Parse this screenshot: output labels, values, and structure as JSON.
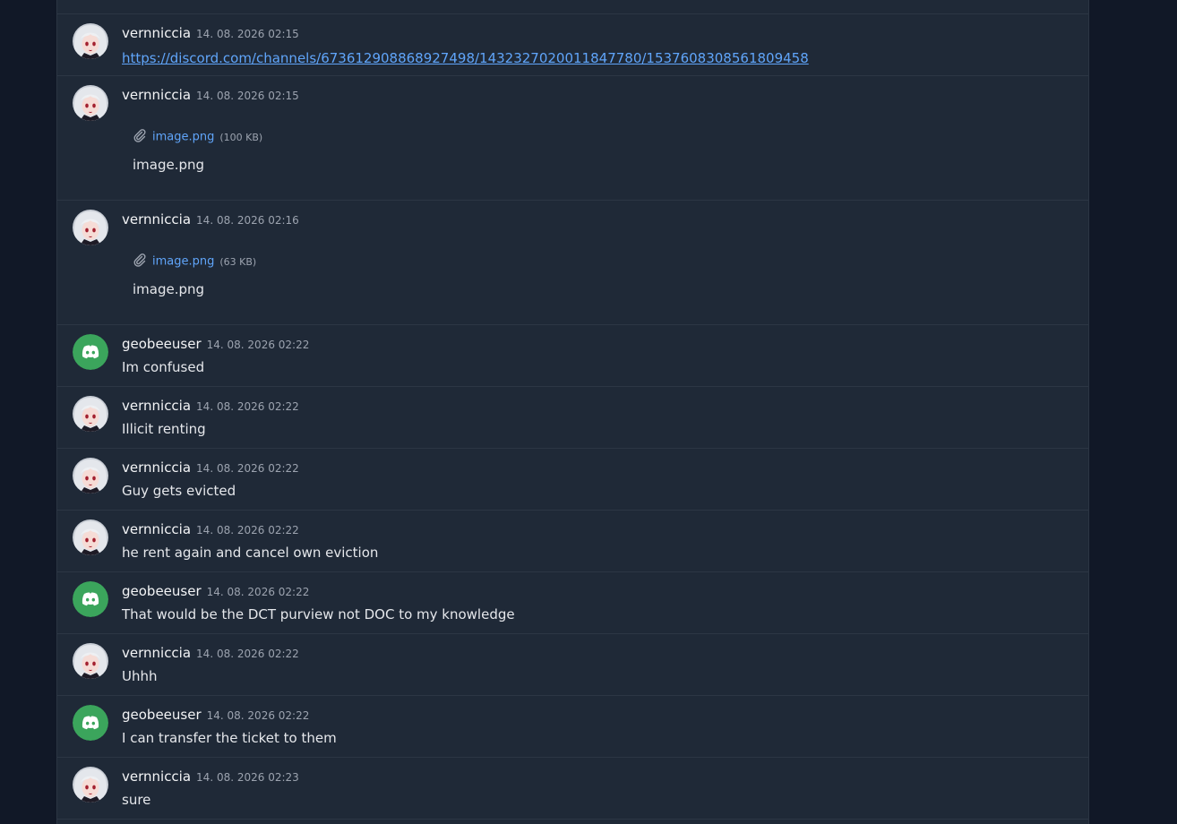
{
  "messages": [
    {
      "id": "m1",
      "author": "vernniccia",
      "timestamp": "14. 08. 2026 02:15",
      "avatar": "anime-avatar-icon",
      "link": "https://discord.com/channels/673612908868927498/1432327020011847780/1537608308561809458"
    },
    {
      "id": "m2",
      "author": "vernniccia",
      "timestamp": "14. 08. 2026 02:15",
      "avatar": "anime-avatar-icon",
      "attachment": {
        "name": "image.png",
        "size": "(100 KB)",
        "caption": "image.png"
      }
    },
    {
      "id": "m3",
      "author": "vernniccia",
      "timestamp": "14. 08. 2026 02:16",
      "avatar": "anime-avatar-icon",
      "attachment": {
        "name": "image.png",
        "size": "(63 KB)",
        "caption": "image.png"
      }
    },
    {
      "id": "m4",
      "author": "geobeeuser",
      "timestamp": "14. 08. 2026 02:22",
      "avatar": "discord-logo-icon",
      "text": "Im confused"
    },
    {
      "id": "m5",
      "author": "vernniccia",
      "timestamp": "14. 08. 2026 02:22",
      "avatar": "anime-avatar-icon",
      "text": "Illicit renting"
    },
    {
      "id": "m6",
      "author": "vernniccia",
      "timestamp": "14. 08. 2026 02:22",
      "avatar": "anime-avatar-icon",
      "text": "Guy gets evicted"
    },
    {
      "id": "m7",
      "author": "vernniccia",
      "timestamp": "14. 08. 2026 02:22",
      "avatar": "anime-avatar-icon",
      "text": "he rent again and cancel own eviction"
    },
    {
      "id": "m8",
      "author": "geobeeuser",
      "timestamp": "14. 08. 2026 02:22",
      "avatar": "discord-logo-icon",
      "text": "That would be the DCT purview not DOC to my knowledge"
    },
    {
      "id": "m9",
      "author": "vernniccia",
      "timestamp": "14. 08. 2026 02:22",
      "avatar": "anime-avatar-icon",
      "text": "Uhhh"
    },
    {
      "id": "m10",
      "author": "geobeeuser",
      "timestamp": "14. 08. 2026 02:22",
      "avatar": "discord-logo-icon",
      "text": "I can transfer the ticket to them"
    },
    {
      "id": "m11",
      "author": "vernniccia",
      "timestamp": "14. 08. 2026 02:23",
      "avatar": "anime-avatar-icon",
      "text": "sure"
    }
  ],
  "colors": {
    "background": "#111827",
    "panel": "#1f2937",
    "link": "#60a5fa",
    "discord_green": "#3ba55c"
  }
}
